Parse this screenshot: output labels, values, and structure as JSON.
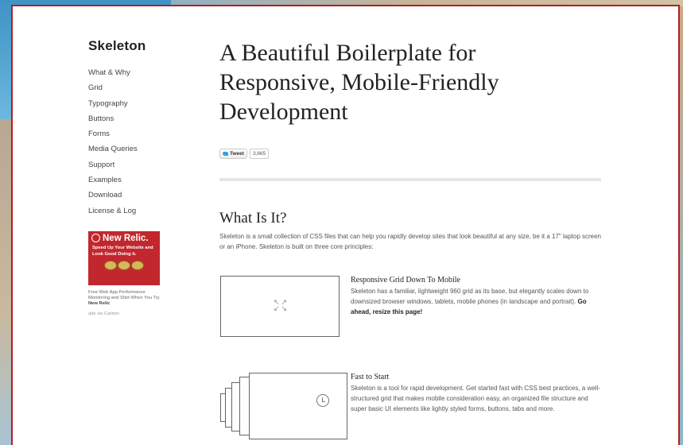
{
  "sidebar": {
    "brand": "Skeleton",
    "nav": [
      "What & Why",
      "Grid",
      "Typography",
      "Buttons",
      "Forms",
      "Media Queries",
      "Support",
      "Examples",
      "Download",
      "License & Log"
    ]
  },
  "ad": {
    "logo_text": "New Relic.",
    "tagline": "Speed Up Your Website and Look Good Doing it.",
    "text": "Free Web App Performance Monitoring and Shirt When You Try",
    "brand_link": "New Relic",
    "via": "ads via Carbon"
  },
  "main": {
    "title": "A Beautiful Boilerplate for Responsive, Mobile-Friendly Development",
    "tweet_label": "Tweet",
    "tweet_count": "3,665",
    "section_title": "What Is It?",
    "intro": "Skeleton is a small collection of CSS files that can help you rapidly develop sites that look beautiful at any size, be it a 17\" laptop screen or an iPhone. Skeleton is built on three core principles:",
    "features": [
      {
        "title": "Responsive Grid Down To Mobile",
        "text": "Skeleton has a familiar, lightweight 960 grid as its base, but elegantly scales down to downsized browser windows, tablets, mobile phones (in landscape and portrait).",
        "emphasis": "Go ahead, resize this page!",
        "icon": "resize-arrows-icon"
      },
      {
        "title": "Fast to Start",
        "text": "Skeleton is a tool for rapid development. Get started fast with CSS best practices, a well-structured grid that makes mobile consideration easy, an organized file structure and super basic UI elements like lightly styled forms, buttons, tabs and more.",
        "emphasis": "",
        "icon": "history-icon"
      }
    ]
  },
  "colors": {
    "frame": "#b21e23",
    "ad_background": "#c2272d",
    "tweet_bird": "#2ea3e0"
  }
}
